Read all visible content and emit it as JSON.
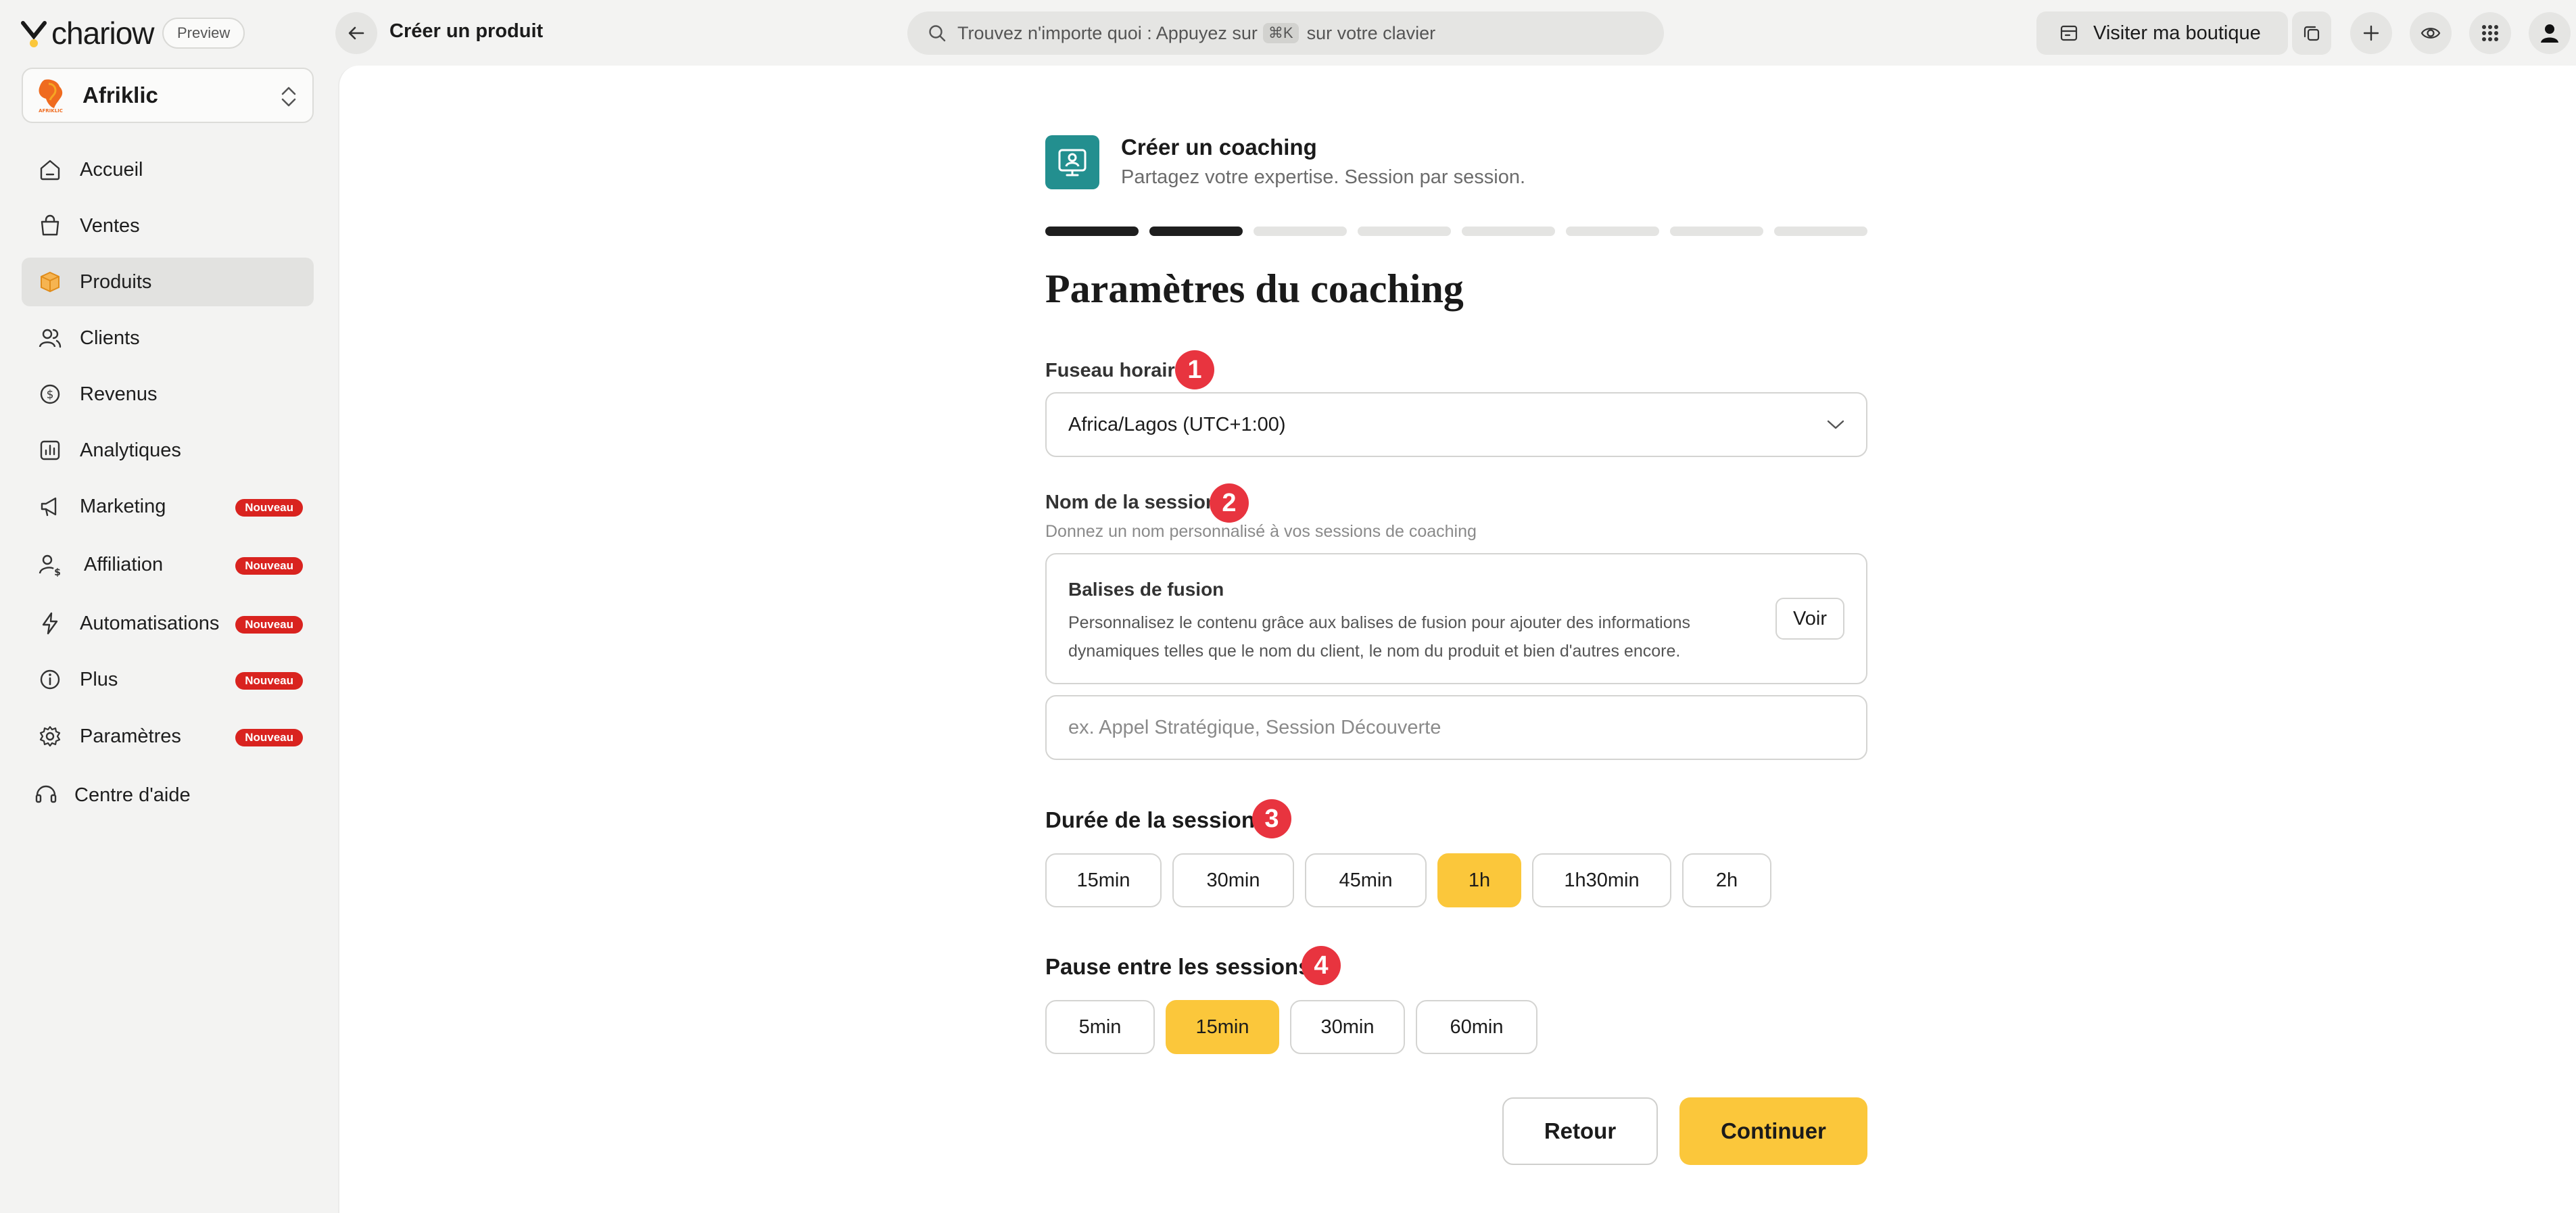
{
  "app": {
    "brand": "chariow",
    "preview_label": "Preview",
    "page_heading": "Créer un produit"
  },
  "search": {
    "prefix": "Trouvez n'importe quoi : Appuyez sur",
    "kbd": "⌘K",
    "suffix": "sur votre clavier"
  },
  "toolbar": {
    "visit_label": "Visiter ma boutique",
    "icons": [
      "copy-icon",
      "plus-icon",
      "eye-icon",
      "apps-grid-icon",
      "user-icon"
    ]
  },
  "store": {
    "name": "Afriklic",
    "logo_text": "AFRIKLIC"
  },
  "sidebar": {
    "items": [
      {
        "label": "Accueil",
        "icon": "home-icon",
        "badge": ""
      },
      {
        "label": "Ventes",
        "icon": "shopping-bag-icon",
        "badge": ""
      },
      {
        "label": "Produits",
        "icon": "box-icon",
        "badge": "",
        "active": true
      },
      {
        "label": "Clients",
        "icon": "users-icon",
        "badge": ""
      },
      {
        "label": "Revenus",
        "icon": "dollar-circle-icon",
        "badge": ""
      },
      {
        "label": "Analytiques",
        "icon": "chart-icon",
        "badge": ""
      },
      {
        "label": "Marketing",
        "icon": "megaphone-icon",
        "badge": "Nouveau"
      },
      {
        "label": "Affiliation",
        "icon": "affiliate-icon",
        "badge": "Nouveau"
      },
      {
        "label": "Automatisations",
        "icon": "lightning-icon",
        "badge": "Nouveau"
      },
      {
        "label": "Plus",
        "icon": "info-icon",
        "badge": "Nouveau"
      },
      {
        "label": "Paramètres",
        "icon": "gear-icon",
        "badge": "Nouveau"
      },
      {
        "label": "Centre d'aide",
        "icon": "help-icon",
        "badge": ""
      }
    ]
  },
  "product_type": {
    "title": "Créer un coaching",
    "subtitle": "Partagez votre expertise. Session par session.",
    "accent": "#238f8f"
  },
  "progress": {
    "total_steps": 8,
    "completed_steps": 2
  },
  "form": {
    "section_title": "Paramètres du coaching",
    "timezone": {
      "label": "Fuseau horaire",
      "marker": "1",
      "value": "Africa/Lagos (UTC+1:00)"
    },
    "session_name": {
      "label": "Nom de la session",
      "marker": "2",
      "helper": "Donnez un nom personnalisé à vos sessions de coaching",
      "merge_title": "Balises de fusion",
      "merge_text": "Personnalisez le contenu grâce aux balises de fusion pour ajouter des informations dynamiques telles que le nom du client, le nom du produit et bien d'autres encore.",
      "merge_button": "Voir",
      "placeholder": "ex. Appel Stratégique, Session Découverte",
      "value": ""
    },
    "duration": {
      "label": "Durée de la session",
      "marker": "3",
      "options": [
        "15min",
        "30min",
        "45min",
        "1h",
        "1h30min",
        "2h"
      ],
      "selected": "1h"
    },
    "break": {
      "label": "Pause entre les sessions",
      "marker": "4",
      "options": [
        "5min",
        "15min",
        "30min",
        "60min"
      ],
      "selected": "15min"
    }
  },
  "actions": {
    "back_label": "Retour",
    "continue_label": "Continuer"
  },
  "colors": {
    "accent_yellow": "#fbc73b",
    "badge_red": "#d9231f",
    "marker_red": "#e8343f"
  }
}
